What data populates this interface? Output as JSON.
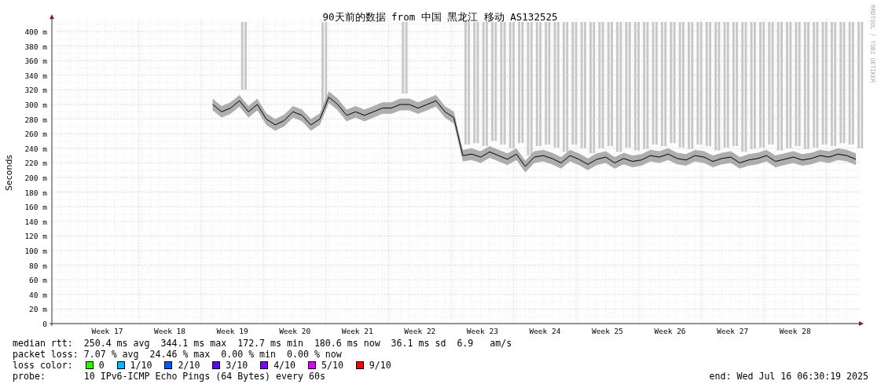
{
  "graph": {
    "title": "90天前的数据 from 中国 黑龙江 移动 AS132525",
    "credit": "RRDTOOL / TOBI OETIKER",
    "chart_data": {
      "type": "line",
      "grid": true,
      "ylabel": "Seconds",
      "ylim": [
        0,
        417
      ],
      "categories": [
        null,
        null,
        null,
        null,
        null,
        null,
        "Week 17",
        null,
        null,
        null,
        null,
        null,
        null,
        "Week 18",
        null,
        null,
        null,
        null,
        null,
        null,
        "Week 19",
        null,
        null,
        null,
        null,
        null,
        null,
        "Week 20",
        null,
        null,
        null,
        null,
        null,
        null,
        "Week 21",
        null,
        null,
        null,
        null,
        null,
        null,
        "Week 22",
        null,
        null,
        null,
        null,
        null,
        null,
        "Week 23",
        null,
        null,
        null,
        null,
        null,
        null,
        "Week 24",
        null,
        null,
        null,
        null,
        null,
        null,
        "Week 25",
        null,
        null,
        null,
        null,
        null,
        null,
        "Week 26",
        null,
        null,
        null,
        null,
        null,
        null,
        "Week 27",
        null,
        null,
        null,
        null,
        null,
        null,
        "Week 28",
        null,
        null,
        null,
        null,
        null,
        null,
        null
      ],
      "yticks": [
        {
          "value": 0,
          "label": "0"
        },
        {
          "value": 20,
          "label": "20 m"
        },
        {
          "value": 40,
          "label": "40 m"
        },
        {
          "value": 60,
          "label": "60 m"
        },
        {
          "value": 80,
          "label": "80 m"
        },
        {
          "value": 100,
          "label": "100 m"
        },
        {
          "value": 120,
          "label": "120 m"
        },
        {
          "value": 140,
          "label": "140 m"
        },
        {
          "value": 160,
          "label": "160 m"
        },
        {
          "value": 180,
          "label": "180 m"
        },
        {
          "value": 200,
          "label": "200 m"
        },
        {
          "value": 220,
          "label": "220 m"
        },
        {
          "value": 240,
          "label": "240 m"
        },
        {
          "value": 260,
          "label": "260 m"
        },
        {
          "value": 280,
          "label": "280 m"
        },
        {
          "value": 300,
          "label": "300 m"
        },
        {
          "value": 320,
          "label": "320 m"
        },
        {
          "value": 340,
          "label": "340 m"
        },
        {
          "value": 360,
          "label": "360 m"
        },
        {
          "value": 380,
          "label": "380 m"
        },
        {
          "value": 400,
          "label": "400 m"
        }
      ],
      "series": [
        {
          "color": "#000000",
          "values": [
            null,
            null,
            null,
            null,
            null,
            null,
            null,
            null,
            null,
            null,
            null,
            null,
            null,
            null,
            null,
            null,
            null,
            null,
            300,
            290,
            295,
            305,
            290,
            300,
            280,
            272,
            278,
            290,
            285,
            272,
            280,
            310,
            300,
            285,
            290,
            285,
            290,
            295,
            295,
            300,
            300,
            295,
            300,
            305,
            290,
            282,
            230,
            232,
            228,
            235,
            230,
            225,
            232,
            215,
            228,
            230,
            226,
            220,
            230,
            225,
            218,
            225,
            228,
            220,
            226,
            222,
            224,
            230,
            228,
            232,
            226,
            224,
            230,
            228,
            222,
            226,
            228,
            220,
            224,
            226,
            230,
            222,
            225,
            228,
            224,
            226,
            230,
            228,
            232,
            230,
            225
          ]
        }
      ]
    }
  },
  "legend": {
    "median_rtt": {
      "label": "median rtt:",
      "values": [
        "250.4 ms avg",
        "344.1 ms max",
        "172.7 ms min",
        "180.6 ms now",
        "36.1 ms sd",
        "6.9   am/s"
      ]
    },
    "packet_loss": {
      "label": "packet loss:",
      "values": [
        "7.07 % avg",
        "24.46 % max",
        "0.00 % min",
        "0.00 % now"
      ]
    },
    "loss_color": {
      "label": "loss color:",
      "items": [
        {
          "label": "0",
          "color": "#26ff00"
        },
        {
          "label": "1/10",
          "color": "#00b8ff"
        },
        {
          "label": "2/10",
          "color": "#0059ff"
        },
        {
          "label": "3/10",
          "color": "#5e00ff"
        },
        {
          "label": "4/10",
          "color": "#7e00ff"
        },
        {
          "label": "5/10",
          "color": "#dd00ff"
        },
        {
          "label": "9/10",
          "color": "#ff0000"
        }
      ]
    },
    "probe": {
      "label": "probe:",
      "value": "10 IPv6-ICMP Echo Pings (64 Bytes) every 60s"
    },
    "end": "end: Wed Jul 16 06:30:19 2025"
  }
}
